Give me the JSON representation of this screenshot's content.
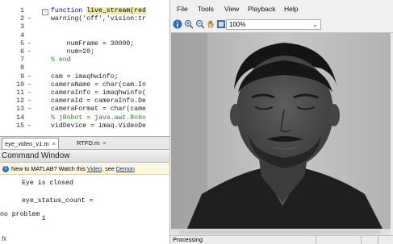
{
  "editor": {
    "lines": [
      {
        "num": "1",
        "mark": "",
        "text": "function live_stream(red",
        "kind": "kw",
        "highlight": "live_stream(red",
        "fold": true
      },
      {
        "num": "2",
        "mark": "–",
        "text": "warning('off','vision:tr",
        "kind": "normal"
      },
      {
        "num": "3",
        "mark": "",
        "text": "",
        "kind": "normal"
      },
      {
        "num": "4",
        "mark": "",
        "text": "",
        "kind": "normal"
      },
      {
        "num": "5",
        "mark": "–",
        "text": "    numFrame = 30000;",
        "kind": "normal"
      },
      {
        "num": "6",
        "mark": "–",
        "text": "    num=20;",
        "kind": "normal"
      },
      {
        "num": "7",
        "mark": "",
        "text": "% end",
        "kind": "cmt"
      },
      {
        "num": "8",
        "mark": "",
        "text": "",
        "kind": "normal"
      },
      {
        "num": "9",
        "mark": "–",
        "text": "cam = imaqhwinfo;",
        "kind": "normal"
      },
      {
        "num": "10",
        "mark": "–",
        "text": "cameraName = char(cam.In",
        "kind": "normal"
      },
      {
        "num": "11",
        "mark": "–",
        "text": "cameraInfo = imaqhwinfo(",
        "kind": "normal"
      },
      {
        "num": "12",
        "mark": "–",
        "text": "cameraId = cameraInfo.De",
        "kind": "normal"
      },
      {
        "num": "13",
        "mark": "–",
        "text": "cameraFormat = char(came",
        "kind": "normal"
      },
      {
        "num": "14",
        "mark": "",
        "text": "% jRobot = java.awt.Robo",
        "kind": "cmt"
      },
      {
        "num": "15",
        "mark": "–",
        "text": "vidDevice = imaq.VideoDe",
        "kind": "normal"
      }
    ]
  },
  "tabs": [
    {
      "label": "eye_video_v1.m",
      "close": "×",
      "active": true
    },
    {
      "label": "RTFD.m",
      "close": "×",
      "active": false
    }
  ],
  "command_window": {
    "title": "Command Window",
    "info_prefix": "New to MATLAB? Watch this ",
    "info_link": "Video",
    "info_mid": ", see ",
    "info_link2": "Demon",
    "output": [
      "Eye is closed",
      "eye_status_count =",
      "     1",
      "no problem"
    ],
    "prompt": "fx"
  },
  "viewer": {
    "menus": [
      "File",
      "Tools",
      "View",
      "Playback",
      "Help"
    ],
    "zoom": "100%",
    "icons": [
      "info-icon",
      "zoom-in-icon",
      "zoom-out-icon",
      "pan-hand-icon",
      "fit-window-icon"
    ],
    "status": [
      "Processing",
      "",
      "",
      ""
    ]
  }
}
